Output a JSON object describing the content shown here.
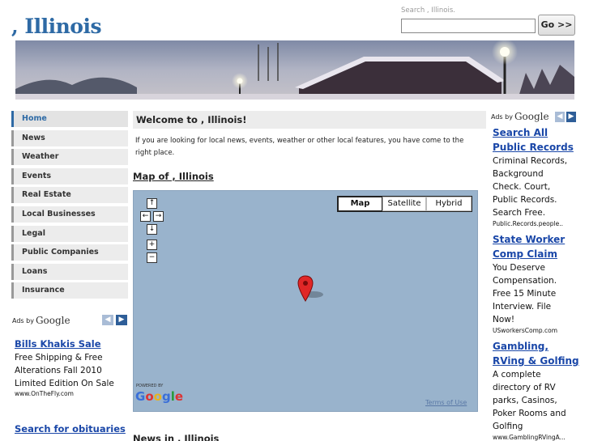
{
  "header": {
    "site_title": ", Illinois",
    "search_label": "Search , Illinois.",
    "search_value": "",
    "go_label": "Go >>"
  },
  "nav": {
    "items": [
      {
        "label": "Home",
        "active": true
      },
      {
        "label": "News"
      },
      {
        "label": "Weather"
      },
      {
        "label": "Events"
      },
      {
        "label": "Real Estate"
      },
      {
        "label": "Local Businesses"
      },
      {
        "label": "Legal"
      },
      {
        "label": "Public Companies"
      },
      {
        "label": "Loans"
      },
      {
        "label": "Insurance"
      }
    ]
  },
  "left_ads": {
    "ads_by": "Ads by",
    "google": "Google",
    "prev_icon": "chevron-left-icon",
    "next_icon": "chevron-right-icon",
    "items": [
      {
        "title": "Bills Khakis Sale",
        "lines": [
          "Free Shipping & Free",
          "Alterations Fall 2010",
          "Limited Edition On Sale"
        ],
        "url": "www.OnTheFly.com"
      },
      {
        "title": "Search for obituaries",
        "lines": [],
        "url": ""
      }
    ]
  },
  "main": {
    "welcome_title": "Welcome to , Illinois!",
    "intro_text": "If you are looking for local news, events, weather or other local features, you have come to the right place.",
    "map_heading": "Map of , Illinois",
    "news_heading": "News in , Illinois"
  },
  "map": {
    "types": [
      "Map",
      "Satellite",
      "Hybrid"
    ],
    "active_type": "Map",
    "controls": {
      "up": "↑",
      "left": "←",
      "right": "→",
      "down": "↓",
      "zoom_in": "+",
      "zoom_out": "−"
    },
    "powered_by": "POWERED BY",
    "logo": "Google",
    "terms": "Terms of Use",
    "marker_icon": "map-marker-icon",
    "background_color": "#99b3cc"
  },
  "right_ads": {
    "ads_by": "Ads by",
    "google": "Google",
    "items": [
      {
        "title_lines": [
          "Search All",
          "Public Records"
        ],
        "lines": [
          "Criminal Records,",
          "Background",
          "Check. Court,",
          "Public Records.",
          "Search Free."
        ],
        "url": "Public.Records.people.."
      },
      {
        "title_lines": [
          "State Worker",
          "Comp Claim"
        ],
        "lines": [
          "You Deserve",
          "Compensation.",
          "Free 15 Minute",
          "Interview. File",
          "Now!"
        ],
        "url": "USworkersComp.com"
      },
      {
        "title_lines": [
          "Gambling,",
          "RVing & Golfing"
        ],
        "lines": [
          "A complete",
          "directory of RV",
          "parks, Casinos,",
          "Poker Rooms and",
          "Golfing"
        ],
        "url": "www.GamblingRVingA..."
      }
    ]
  },
  "colors": {
    "brand_blue": "#2e6aa5",
    "ad_link": "#1a47a8",
    "nav_bg": "#ececec"
  }
}
